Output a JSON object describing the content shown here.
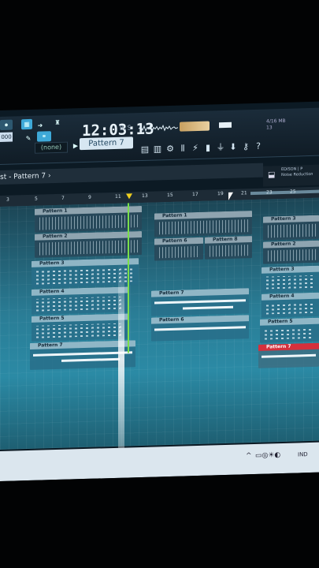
{
  "toolbar": {
    "clock": "12:03:13",
    "clock_sub": "B:S",
    "pattern_selector": "Pattern 7",
    "none_selector": "(none)",
    "time_button": "000",
    "memory": [
      "4/16 MB",
      "13"
    ],
    "edison": [
      "EDISON | P",
      "Noise Reduction"
    ]
  },
  "playlist": {
    "title": "st - Pattern 7 ›",
    "ruler": [
      "3",
      "5",
      "7",
      "9",
      "11",
      "13",
      "15",
      "17",
      "19",
      "21",
      "23",
      "25"
    ],
    "clips": [
      {
        "label": "Pattern 1",
        "kind": "drum"
      },
      {
        "label": "Pattern 2",
        "kind": "drum"
      },
      {
        "label": "Pattern 3",
        "kind": "melo"
      },
      {
        "label": "Pattern 4",
        "kind": "melo"
      },
      {
        "label": "Pattern 5",
        "kind": "melo"
      },
      {
        "label": "Pattern 7",
        "kind": "long"
      },
      {
        "label": "Pattern 1",
        "kind": "drum"
      },
      {
        "label": "Pattern 6",
        "kind": "drum"
      },
      {
        "label": "Pattern 8",
        "kind": "drum"
      },
      {
        "label": "Pattern 7",
        "kind": "long"
      },
      {
        "label": "Pattern 6",
        "kind": "long"
      },
      {
        "label": "Pattern 3",
        "kind": "drum"
      },
      {
        "label": "Pattern 2",
        "kind": "drum"
      },
      {
        "label": "Pattern 3",
        "kind": "melo"
      },
      {
        "label": "Pattern 4",
        "kind": "melo"
      },
      {
        "label": "Pattern 5",
        "kind": "melo"
      },
      {
        "label": "Pattern 7",
        "kind": "red"
      }
    ]
  },
  "taskbar": {
    "lang": "IND",
    "arrow": "^"
  },
  "colors": {
    "accent": "#2b8aa5",
    "playhead": "#7ae04a",
    "marker": "#f0d020",
    "red_clip": "#d5303c"
  }
}
